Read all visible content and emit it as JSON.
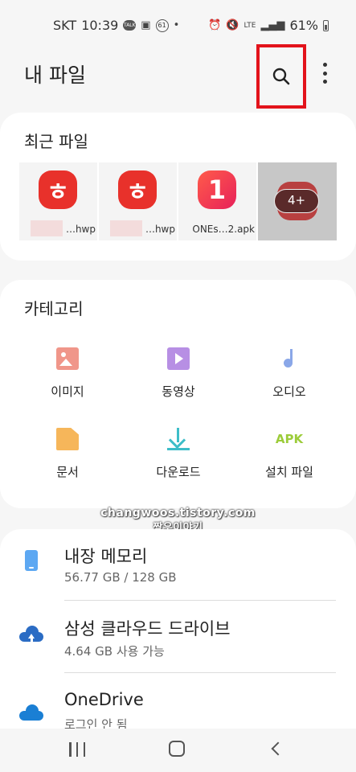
{
  "status_bar": {
    "carrier": "SKT",
    "time": "10:39",
    "notification_count": "61",
    "battery": "61%",
    "lte": "LTE"
  },
  "header": {
    "title": "내 파일"
  },
  "recent": {
    "title": "최근 파일",
    "files": [
      {
        "icon": "hwp-app-icon",
        "name": "…hwp",
        "glyph": "ㅎ"
      },
      {
        "icon": "hwp-app-icon",
        "name": "…hwp",
        "glyph": "ㅎ"
      },
      {
        "icon": "onestore-app-icon",
        "name": "ONEs…2.apk",
        "glyph": "1"
      }
    ],
    "more_badge": "4+"
  },
  "categories": {
    "title": "카테고리",
    "items": [
      {
        "label": "이미지",
        "icon": "image-icon"
      },
      {
        "label": "동영상",
        "icon": "video-icon"
      },
      {
        "label": "오디오",
        "icon": "audio-icon"
      },
      {
        "label": "문서",
        "icon": "document-icon"
      },
      {
        "label": "다운로드",
        "icon": "download-icon"
      },
      {
        "label": "설치 파일",
        "icon": "apk-icon",
        "icon_text": "APK"
      }
    ]
  },
  "watermark": {
    "line1": "changwoos.tistory.com",
    "line2": "짱우이야기"
  },
  "storage": {
    "items": [
      {
        "name": "내장 메모리",
        "detail": "56.77 GB / 128 GB",
        "icon": "phone-icon"
      },
      {
        "name": "삼성 클라우드 드라이브",
        "detail": "4.64 GB 사용 가능",
        "icon": "samsung-cloud-icon"
      },
      {
        "name": "OneDrive",
        "detail": "로그인 안 됨",
        "icon": "onedrive-icon"
      }
    ]
  },
  "colors": {
    "highlight_box": "#e3131b",
    "hwp_red": "#e8312b",
    "apk_green": "#9ccc3a"
  }
}
